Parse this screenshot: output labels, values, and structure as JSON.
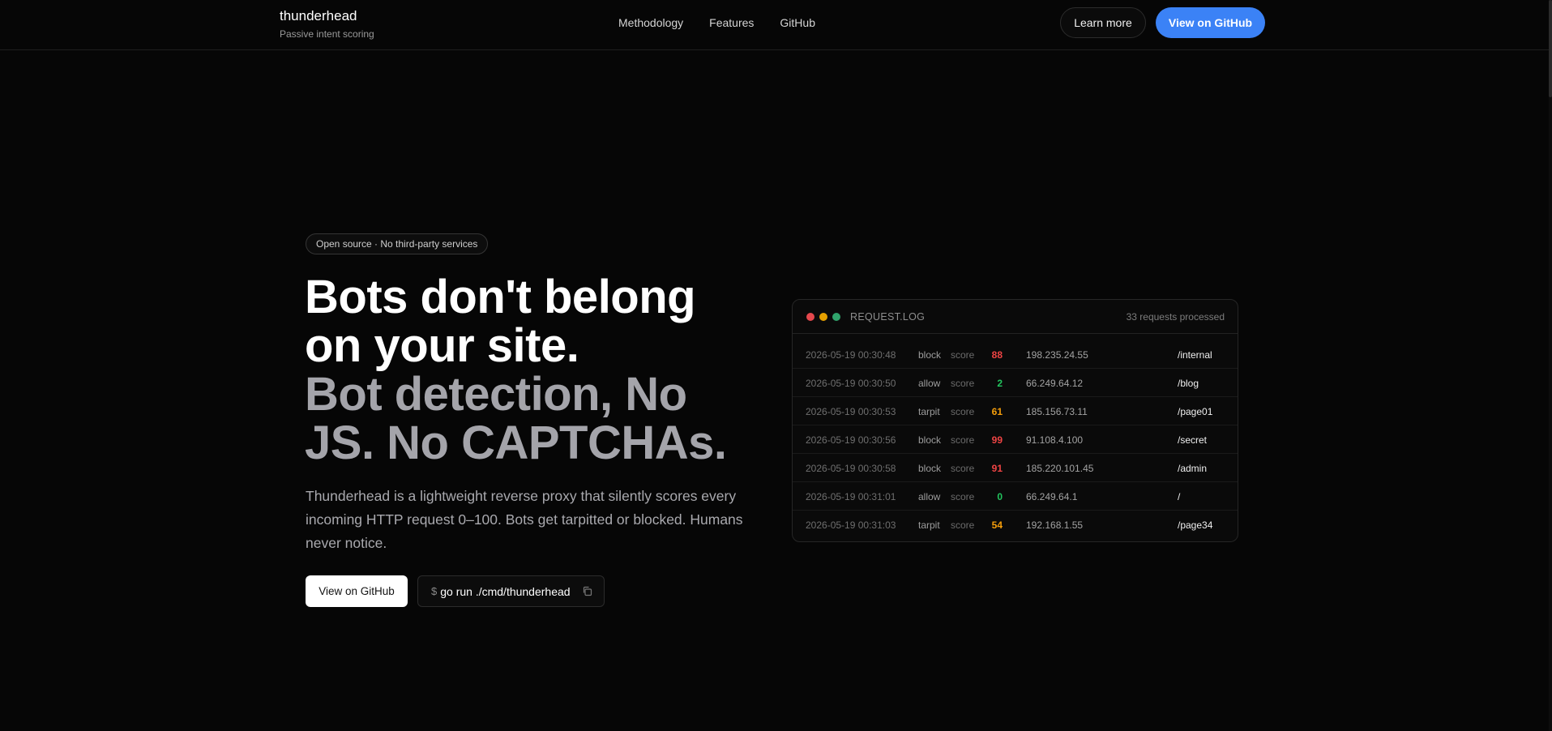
{
  "header": {
    "brand_name": "thunderhead",
    "brand_tagline": "Passive intent scoring",
    "nav": [
      "Methodology",
      "Features",
      "GitHub"
    ],
    "learn_more_label": "Learn more",
    "view_github_label": "View on GitHub"
  },
  "hero": {
    "badge": "Open source · No third-party services",
    "headline_line1": "Bots don't belong",
    "headline_line2": "on your site.",
    "headline_line3": "Bot detection, No",
    "headline_line4": "JS. No CAPTCHAs.",
    "description": "Thunderhead is a lightweight reverse proxy that silently scores every incoming HTTP request 0–100. Bots get tarpitted or blocked. Humans never notice.",
    "cta_github_label": "View on GitHub",
    "command_prompt": "$",
    "command": "go run ./cmd/thunderhead"
  },
  "request_log": {
    "title": "REQUEST.LOG",
    "count": "33 requests processed",
    "score_label": "score",
    "colors": {
      "block": "#ef4444",
      "allow": "#22c55e",
      "tarpit": "#f59e0b"
    },
    "rows": [
      {
        "timestamp": "2026-05-19 00:30:48",
        "action": "block",
        "score": "88",
        "ip": "198.235.24.55",
        "path": "/internal"
      },
      {
        "timestamp": "2026-05-19 00:30:50",
        "action": "allow",
        "score": "2",
        "ip": "66.249.64.12",
        "path": "/blog"
      },
      {
        "timestamp": "2026-05-19 00:30:53",
        "action": "tarpit",
        "score": "61",
        "ip": "185.156.73.11",
        "path": "/page01"
      },
      {
        "timestamp": "2026-05-19 00:30:56",
        "action": "block",
        "score": "99",
        "ip": "91.108.4.100",
        "path": "/secret"
      },
      {
        "timestamp": "2026-05-19 00:30:58",
        "action": "block",
        "score": "91",
        "ip": "185.220.101.45",
        "path": "/admin"
      },
      {
        "timestamp": "2026-05-19 00:31:01",
        "action": "allow",
        "score": "0",
        "ip": "66.249.64.1",
        "path": "/"
      },
      {
        "timestamp": "2026-05-19 00:31:03",
        "action": "tarpit",
        "score": "54",
        "ip": "192.168.1.55",
        "path": "/page34"
      }
    ]
  }
}
